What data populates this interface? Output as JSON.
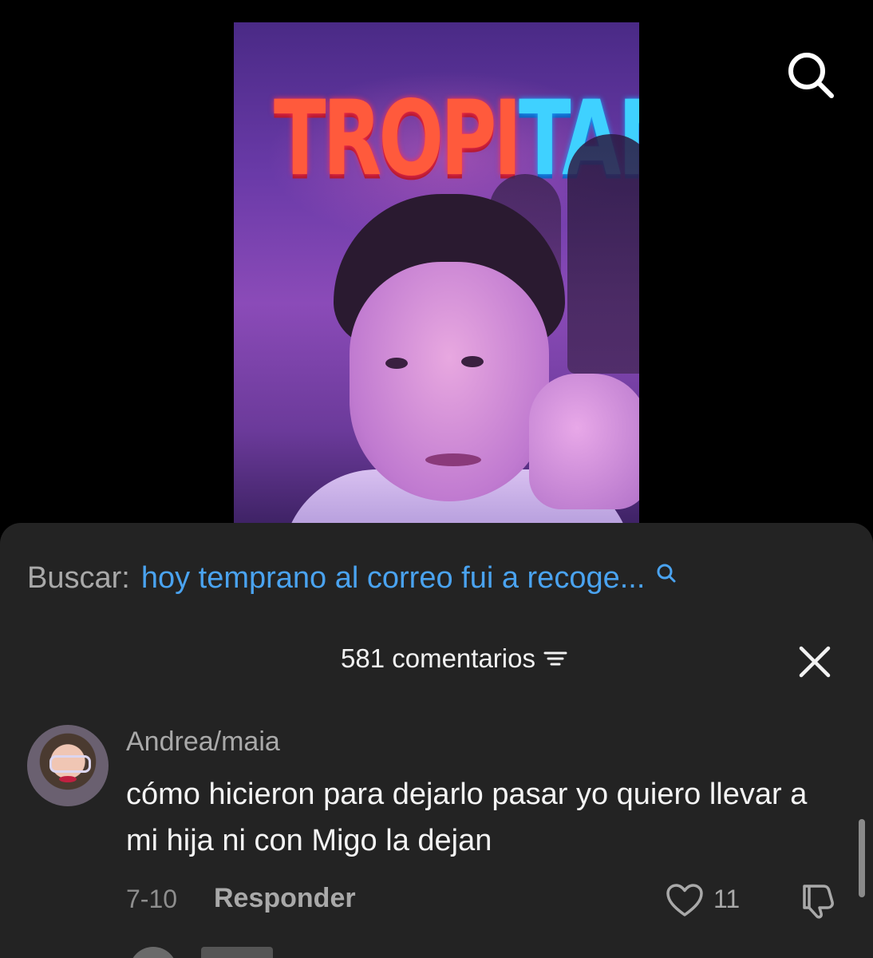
{
  "video": {
    "sign_left": "TROPI",
    "sign_right": "TANG"
  },
  "search": {
    "label": "Buscar:",
    "query": "hoy temprano al correo fui a recoge..."
  },
  "comments_header": {
    "count_label": "581 comentarios"
  },
  "comment": {
    "username": "Andrea/maia",
    "text": "cómo hicieron para dejarlo pasar yo quiero llevar a mi hija ni con Migo la dejan",
    "date": "7-10",
    "reply_label": "Responder",
    "likes": "11"
  },
  "colors": {
    "sheet_bg": "#232323",
    "search_query": "#4aa3f0",
    "muted_text": "#a9a9a9"
  },
  "icons": {
    "search": "search-icon",
    "close": "close-icon",
    "sort": "sort-icon",
    "like": "heart-icon",
    "dislike": "thumbs-down-icon"
  }
}
